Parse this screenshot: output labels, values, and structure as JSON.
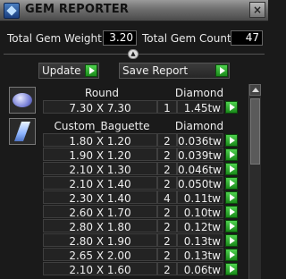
{
  "window": {
    "title": "GEM REPORTER",
    "close": "×"
  },
  "stats": {
    "total_weight_label": "Total Gem Weight",
    "total_weight_value": "3.20",
    "total_count_label": "Total Gem Count",
    "total_count_value": "47"
  },
  "actions": {
    "update_label": "Update",
    "save_report_label": "Save Report"
  },
  "groups": [
    {
      "cut": "Round",
      "type": "Diamond",
      "icon": "round-gem-icon",
      "rows": [
        {
          "size": "7.30 X 7.30",
          "qty": "1",
          "weight": "1.45tw"
        }
      ]
    },
    {
      "cut": "Custom_Baguette",
      "type": "Diamond",
      "icon": "baguette-gem-icon",
      "rows": [
        {
          "size": "1.80 X 1.20",
          "qty": "2",
          "weight": "0.036tw"
        },
        {
          "size": "1.90 X 1.20",
          "qty": "2",
          "weight": "0.039tw"
        },
        {
          "size": "2.10 X 1.30",
          "qty": "2",
          "weight": "0.046tw"
        },
        {
          "size": "2.10 X 1.40",
          "qty": "2",
          "weight": "0.050tw"
        },
        {
          "size": "2.30 X 1.40",
          "qty": "4",
          "weight": "0.11tw"
        },
        {
          "size": "2.60 X 1.70",
          "qty": "2",
          "weight": "0.10tw"
        },
        {
          "size": "2.80 X 1.80",
          "qty": "2",
          "weight": "0.12tw"
        },
        {
          "size": "2.80 X 1.90",
          "qty": "2",
          "weight": "0.13tw"
        },
        {
          "size": "2.65 X 2.00",
          "qty": "2",
          "weight": "0.13tw"
        },
        {
          "size": "2.10 X 1.60",
          "qty": "2",
          "weight": "0.06tw"
        }
      ]
    }
  ],
  "colors": {
    "accent_green": "#2fb42f",
    "background": "#1a1a1a",
    "titlebar": "#7a7a7a"
  }
}
